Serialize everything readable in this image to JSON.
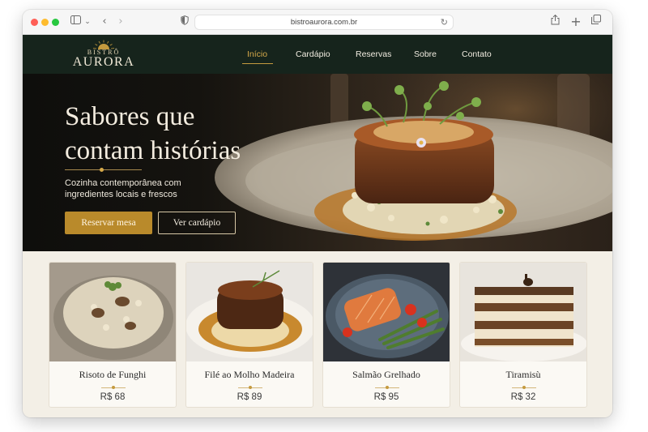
{
  "browser": {
    "url": "bistroaurora.com.br"
  },
  "brand": {
    "small": "BISTRÔ",
    "name": "AURORA"
  },
  "nav": {
    "items": [
      {
        "label": "Início",
        "active": true
      },
      {
        "label": "Cardápio",
        "active": false
      },
      {
        "label": "Reservas",
        "active": false
      },
      {
        "label": "Sobre",
        "active": false
      },
      {
        "label": "Contato",
        "active": false
      }
    ]
  },
  "hero": {
    "title_line1": "Sabores que",
    "title_line2": "contam histórias",
    "subtitle_line1": "Cozinha contemporânea com",
    "subtitle_line2": "ingredientes locais e frescos",
    "primary_button": "Reservar mesa",
    "secondary_button": "Ver cardápio"
  },
  "menu": {
    "items": [
      {
        "name": "Risoto de Funghi",
        "price": "R$ 68"
      },
      {
        "name": "Filé ao Molho Madeira",
        "price": "R$ 89"
      },
      {
        "name": "Salmão Grelhado",
        "price": "R$ 95"
      },
      {
        "name": "Tiramisù",
        "price": "R$ 32"
      }
    ]
  },
  "colors": {
    "nav_bg": "#16241c",
    "accent_gold": "#b98a2b",
    "active_nav": "#d7aa4a",
    "cards_bg": "#f3efe6"
  },
  "icons": {
    "sidebar": "sidebar-icon",
    "back": "chevron-left-icon",
    "forward": "chevron-right-icon",
    "privacy": "shield-icon",
    "reload": "reload-icon",
    "share": "share-icon",
    "new_tab": "plus-icon",
    "tabs": "tabs-overview-icon"
  }
}
